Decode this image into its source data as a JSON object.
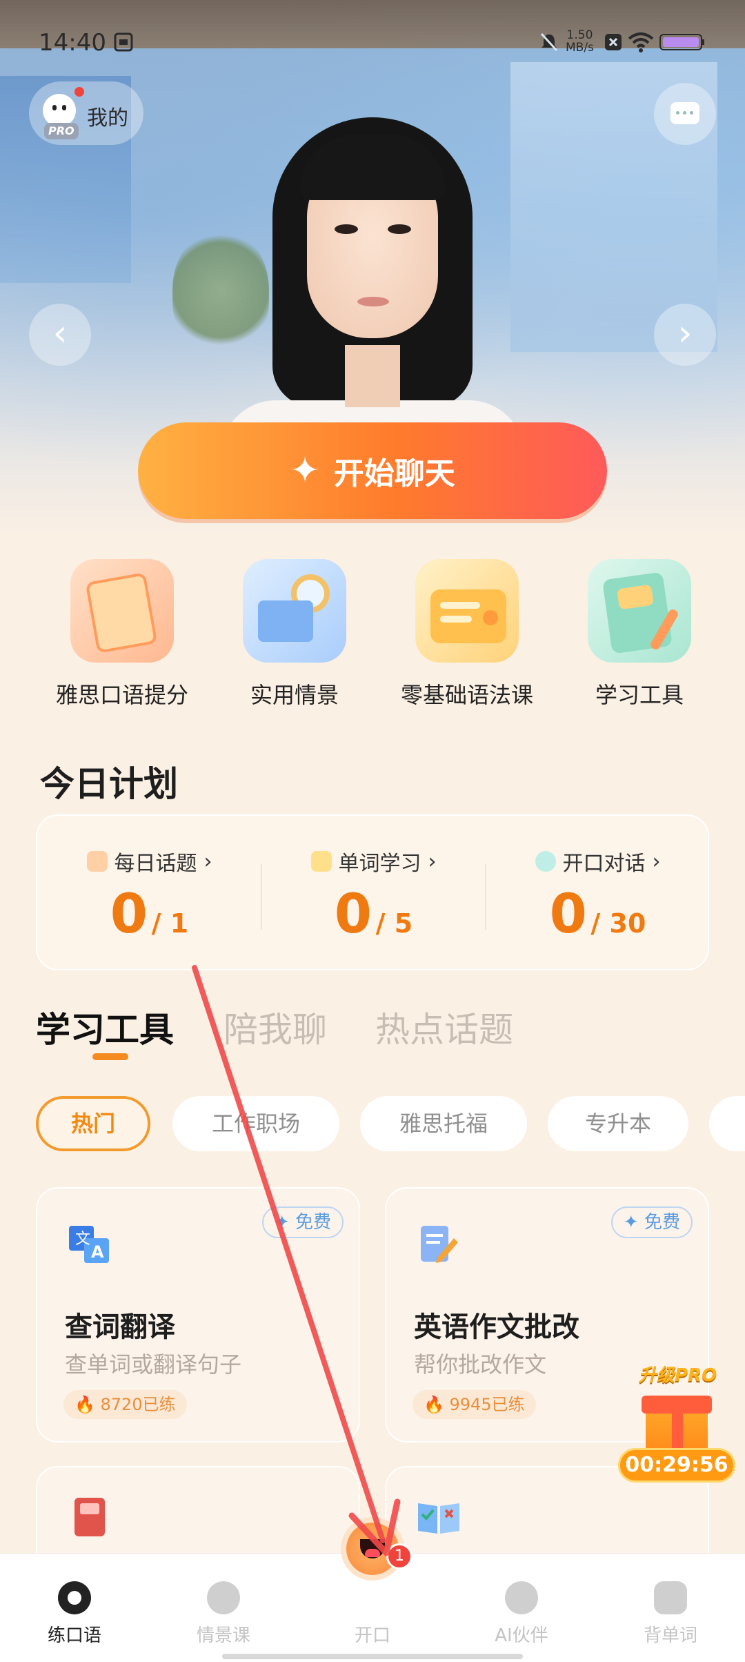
{
  "status_bar": {
    "time": "14:40",
    "net_speed_value": "1.50",
    "net_speed_unit": "MB/s"
  },
  "header": {
    "me_label": "我的",
    "pro_tag": "PRO"
  },
  "hero": {
    "start_chat_label": "开始聊天",
    "prev_icon": "chevron-left-icon",
    "next_icon": "chevron-right-icon"
  },
  "quick_entries": [
    {
      "label": "雅思口语提分",
      "icon": "ielts-book-icon",
      "color": "#ffb890"
    },
    {
      "label": "实用情景",
      "icon": "magnifier-book-icon",
      "color": "#b9d7fb"
    },
    {
      "label": "零基础语法课",
      "icon": "radio-icon",
      "color": "#ffd27a"
    },
    {
      "label": "学习工具",
      "icon": "notepad-icon",
      "color": "#b6ead8"
    }
  ],
  "today_plan": {
    "title": "今日计划",
    "items": [
      {
        "label": "每日话题",
        "done": "0",
        "total": "/ 1",
        "icon": "topic-icon"
      },
      {
        "label": "单词学习",
        "done": "0",
        "total": "/ 5",
        "icon": "word-icon"
      },
      {
        "label": "开口对话",
        "done": "0",
        "total": "/ 30",
        "icon": "chat-bubble-icon"
      }
    ]
  },
  "tabs": [
    "学习工具",
    "陪我聊",
    "热点话题"
  ],
  "chips": [
    "热门",
    "工作职场",
    "雅思托福",
    "专升本",
    ""
  ],
  "tools": [
    {
      "badge": "免费",
      "title": "查词翻译",
      "subtitle": "查单词或翻译句子",
      "count": "8720已练"
    },
    {
      "badge": "免费",
      "title": "英语作文批改",
      "subtitle": "帮你批改作文",
      "count": "9945已练"
    }
  ],
  "gift": {
    "label": "升级PRO",
    "timer": "00:29:56"
  },
  "bottom_nav": [
    "练口语",
    "情景课",
    "开口",
    "AI伙伴",
    "背单词"
  ],
  "center_badge": "1",
  "colors": {
    "accent": "#f58a20",
    "chip_active": "#f29a2c",
    "arrow": "#ef4a4a"
  }
}
